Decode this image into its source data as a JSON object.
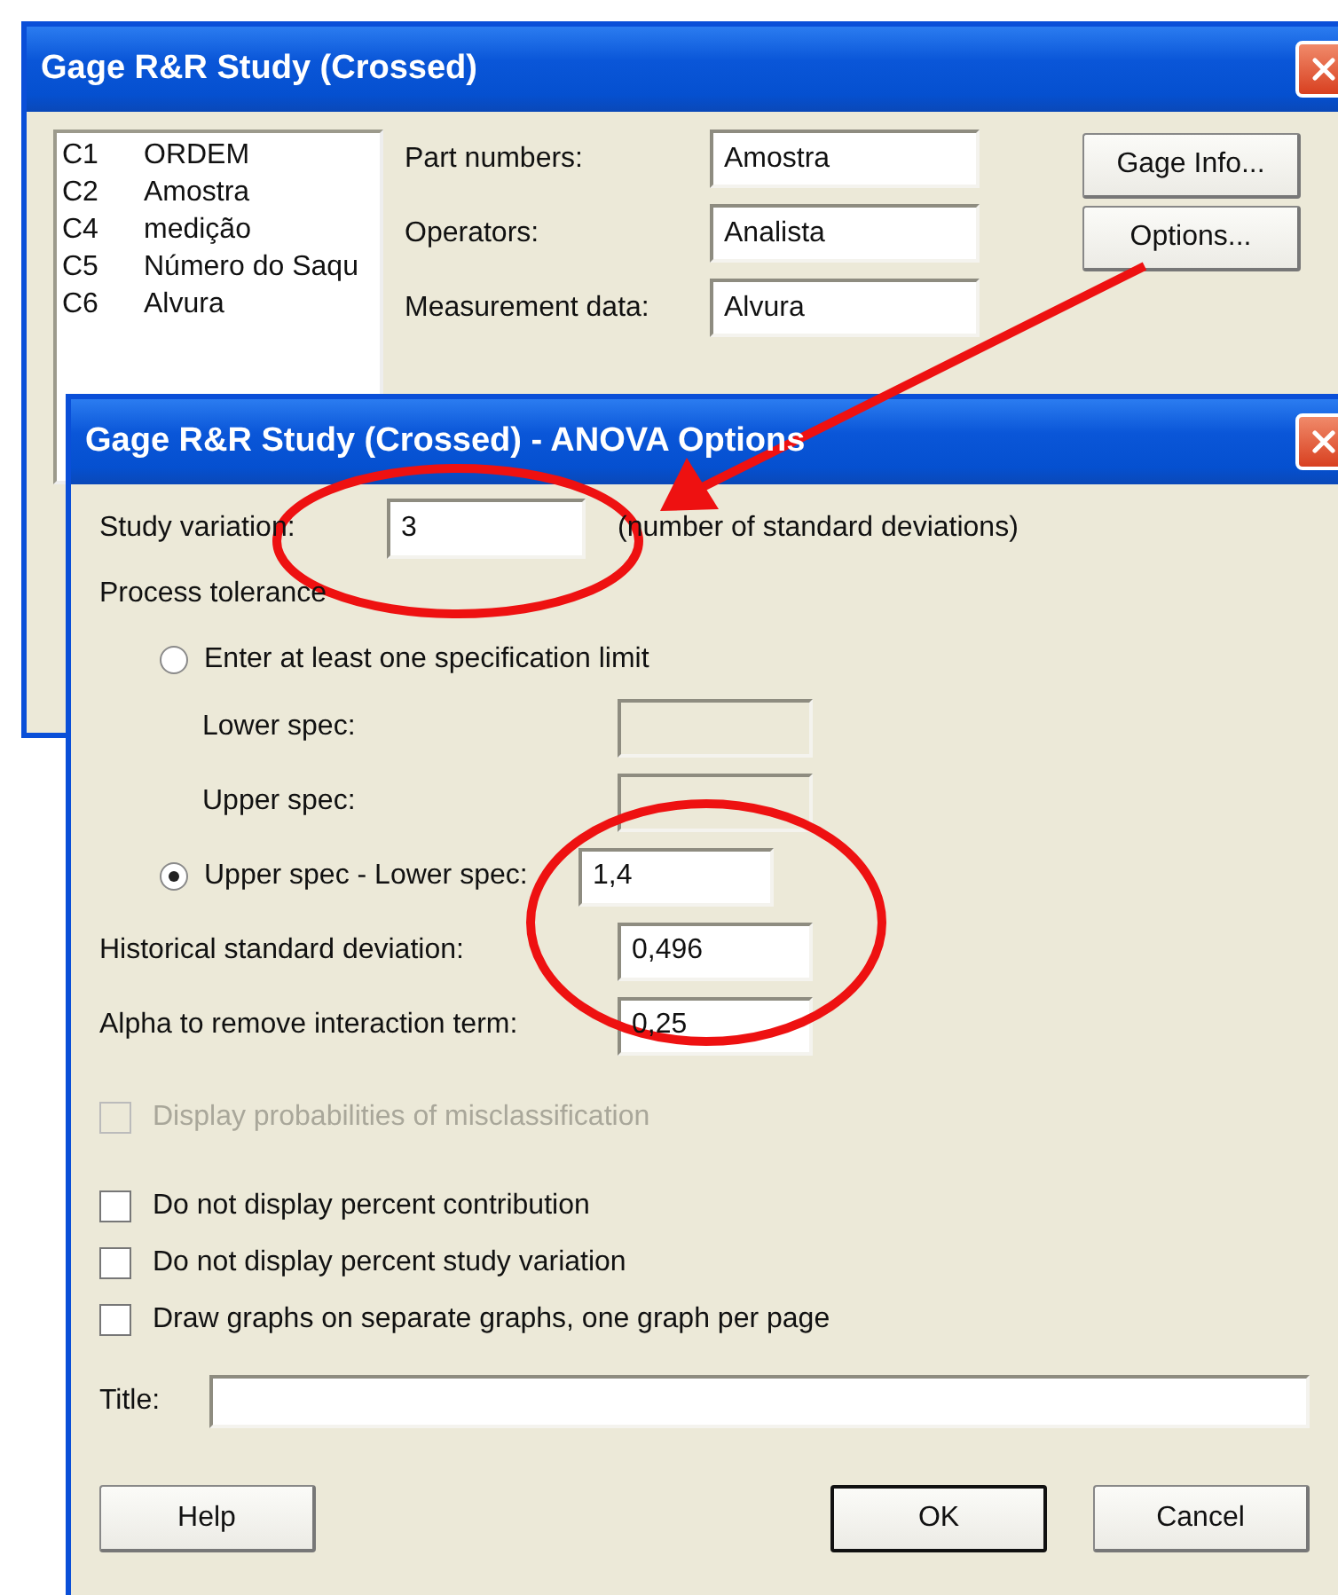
{
  "main_dialog": {
    "title": "Gage R&R Study (Crossed)",
    "columns": [
      {
        "id": "C1",
        "name": "ORDEM"
      },
      {
        "id": "C2",
        "name": "Amostra"
      },
      {
        "id": "C4",
        "name": "medição"
      },
      {
        "id": "C5",
        "name": "Número do Saqu"
      },
      {
        "id": "C6",
        "name": "Alvura"
      }
    ],
    "fields": [
      {
        "label": "Part numbers:",
        "value": "Amostra"
      },
      {
        "label": "Operators:",
        "value": "Analista"
      },
      {
        "label": "Measurement data:",
        "value": "Alvura"
      }
    ],
    "buttons": [
      "Gage Info...",
      "Options..."
    ]
  },
  "options_dialog": {
    "title": "Gage R&R Study (Crossed) - ANOVA Options",
    "study_variation": {
      "label": "Study variation:",
      "value": "3",
      "note": "(number of standard deviations)"
    },
    "process_tolerance": {
      "label": "Process tolerance",
      "choices": [
        {
          "label": "Enter at least one specification limit",
          "selected": false
        },
        {
          "label": "Upper spec - Lower spec:",
          "selected": true,
          "value": "1,4"
        }
      ],
      "spec_fields": [
        {
          "label": "Lower spec:",
          "disabled": true
        },
        {
          "label": "Upper spec:",
          "disabled": true
        }
      ]
    },
    "historical": {
      "label": "Historical standard deviation:",
      "value": "0,496"
    },
    "alpha": {
      "label": "Alpha to remove interaction term:",
      "value": "0,25"
    },
    "checkboxes": [
      {
        "label": "Display probabilities of misclassification",
        "checked": false,
        "disabled": true
      },
      {
        "label": "Do not display percent contribution",
        "checked": false,
        "disabled": false
      },
      {
        "label": "Do not display percent study variation",
        "checked": false,
        "disabled": false
      },
      {
        "label": "Draw graphs on separate graphs, one graph per page",
        "checked": false,
        "disabled": false
      }
    ],
    "title_field": {
      "label": "Title:"
    },
    "buttons": [
      {
        "label": "Help",
        "default": false
      },
      {
        "label": "OK",
        "default": true
      },
      {
        "label": "Cancel",
        "default": false
      }
    ]
  },
  "annotations": [
    {
      "kind": "ellipse"
    },
    {
      "kind": "ellipse"
    },
    {
      "kind": "arrow"
    }
  ]
}
